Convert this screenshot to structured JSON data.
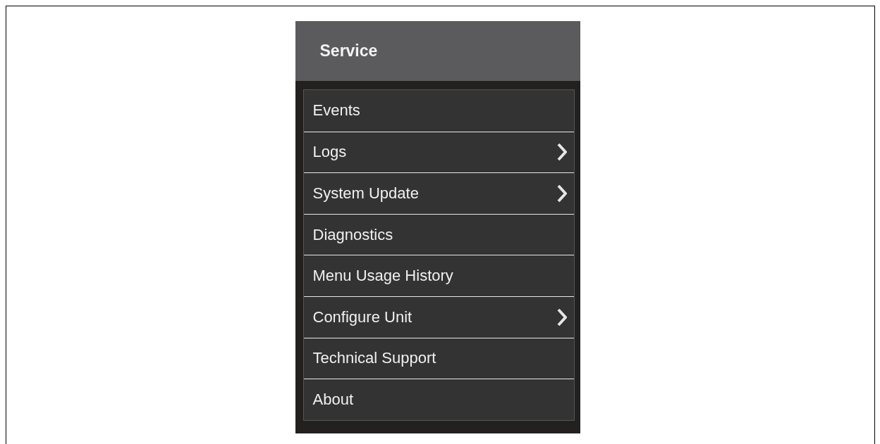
{
  "menu": {
    "title": "Service",
    "items": [
      {
        "label": "Events",
        "submenu": false
      },
      {
        "label": "Logs",
        "submenu": true
      },
      {
        "label": "System Update",
        "submenu": true
      },
      {
        "label": "Diagnostics",
        "submenu": false
      },
      {
        "label": "Menu Usage History",
        "submenu": false
      },
      {
        "label": "Configure Unit",
        "submenu": true
      },
      {
        "label": "Technical Support",
        "submenu": false
      },
      {
        "label": "About",
        "submenu": false
      }
    ]
  }
}
